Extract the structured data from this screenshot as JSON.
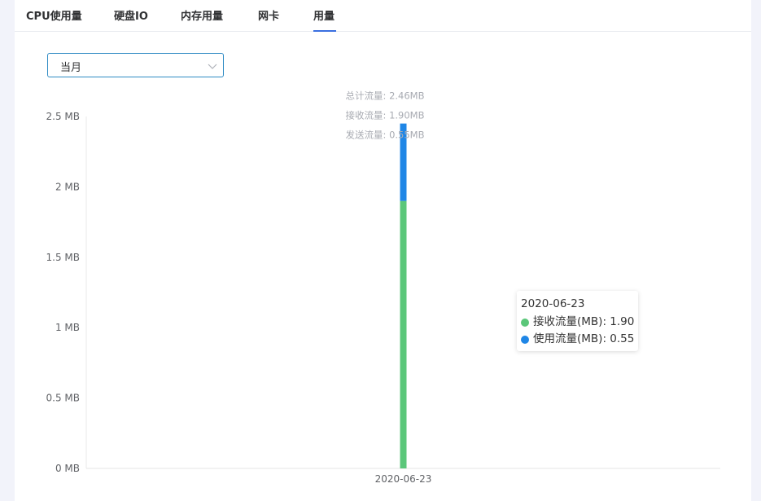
{
  "tabs": [
    {
      "label": "CPU使用量"
    },
    {
      "label": "硬盘IO"
    },
    {
      "label": "内存用量"
    },
    {
      "label": "网卡"
    },
    {
      "label": "用量",
      "active": true
    }
  ],
  "period_select": {
    "value": "当月"
  },
  "colors": {
    "received": "#5bc77a",
    "sent": "#1f86e6",
    "accent": "#3a6fe0"
  },
  "chart_data": {
    "type": "bar",
    "stacked": true,
    "categories": [
      "2020-06-23"
    ],
    "series": [
      {
        "name": "接收流量(MB)",
        "values": [
          1.9
        ]
      },
      {
        "name": "使用流量(MB)",
        "values": [
          0.55
        ]
      }
    ],
    "ylim": [
      0,
      2.5
    ],
    "yticks": [
      {
        "value": 0,
        "label": "0 MB"
      },
      {
        "value": 0.5,
        "label": "0.5 MB"
      },
      {
        "value": 1,
        "label": "1 MB"
      },
      {
        "value": 1.5,
        "label": "1.5 MB"
      },
      {
        "value": 2,
        "label": "2 MB"
      },
      {
        "value": 2.5,
        "label": "2.5 MB"
      }
    ],
    "annotations": [
      "总计流量: 2.46MB",
      "接收流量: 1.90MB",
      "发送流量: 0.55MB"
    ],
    "grid": false
  },
  "tooltip": {
    "title": "2020-06-23",
    "rows": [
      {
        "label": "接收流量(MB): 1.90"
      },
      {
        "label": "使用流量(MB): 0.55"
      }
    ]
  }
}
